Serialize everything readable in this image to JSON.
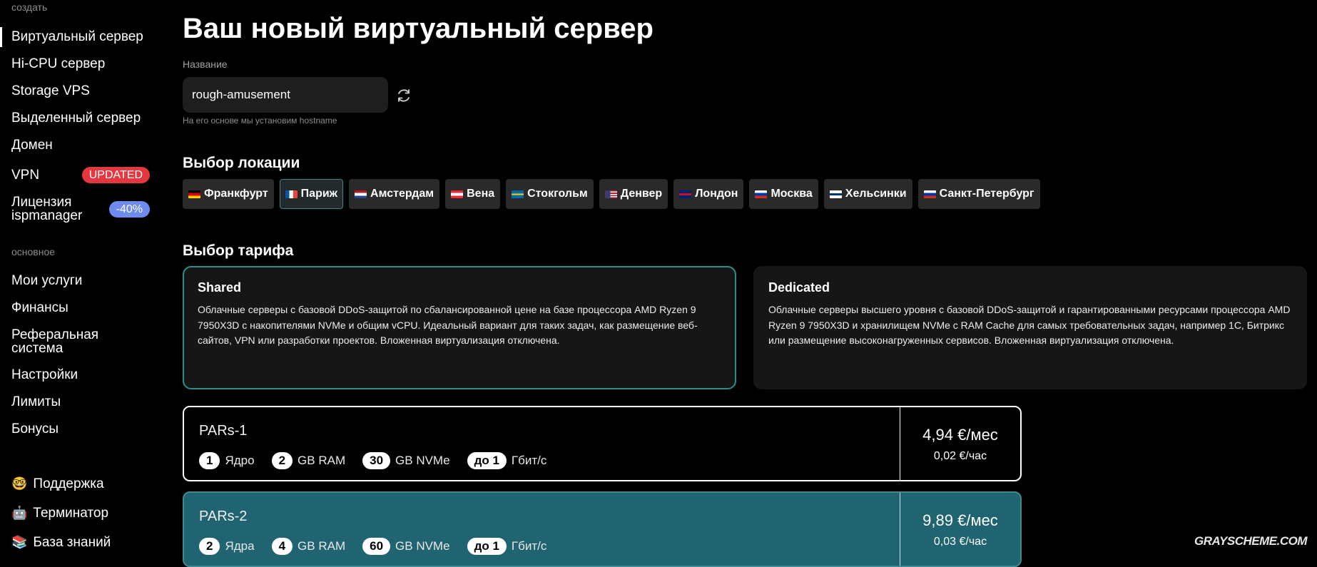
{
  "sidebar": {
    "section_create": "создать",
    "section_main": "основное",
    "create_items": [
      {
        "label": "Виртуальный сервер"
      },
      {
        "label": "Hi-CPU сервер"
      },
      {
        "label": "Storage VPS"
      },
      {
        "label": "Выделенный сервер"
      },
      {
        "label": "Домен"
      },
      {
        "label": "VPN",
        "badge": "UPDATED"
      },
      {
        "label": "Лицензия ispmanager",
        "badge": "-40%"
      }
    ],
    "main_items": [
      {
        "label": "Мои услуги"
      },
      {
        "label": "Финансы"
      },
      {
        "label": "Реферальная система"
      },
      {
        "label": "Настройки"
      },
      {
        "label": "Лимиты"
      },
      {
        "label": "Бонусы"
      }
    ],
    "support_items": [
      {
        "emoji": "🤓",
        "label": "Поддержка"
      },
      {
        "emoji": "🤖",
        "label": "Терминатор"
      },
      {
        "emoji": "📚",
        "label": "База знаний"
      }
    ]
  },
  "page": {
    "title": "Ваш новый виртуальный сервер",
    "name_label": "Название",
    "name_value": "rough-amusement",
    "name_hint": "На его основе мы установим hostname",
    "location_title": "Выбор локации",
    "tariff_title": "Выбор тарифа"
  },
  "locations": [
    {
      "label": "Франкфурт",
      "flag": "de"
    },
    {
      "label": "Париж",
      "flag": "fr",
      "selected": true
    },
    {
      "label": "Амстердам",
      "flag": "nl"
    },
    {
      "label": "Вена",
      "flag": "at"
    },
    {
      "label": "Стокгольм",
      "flag": "se"
    },
    {
      "label": "Денвер",
      "flag": "us"
    },
    {
      "label": "Лондон",
      "flag": "gb"
    },
    {
      "label": "Москва",
      "flag": "ru"
    },
    {
      "label": "Хельсинки",
      "flag": "fi"
    },
    {
      "label": "Санкт-Петербург",
      "flag": "ru"
    }
  ],
  "tariffs": [
    {
      "title": "Shared",
      "description": "Облачные серверы с базовой DDoS-защитой по сбалансированной цене на базе процессора AMD Ryzen 9 7950X3D с накопителями NVMe и общим vCPU. Идеальный вариант для таких задач, как размещение веб-сайтов, VPN или разработки проектов. Вложенная виртуализация отключена."
    },
    {
      "title": "Dedicated",
      "description": "Облачные серверы высшего уровня с базовой DDoS-защитой и гарантированными ресурсами процессора AMD Ryzen 9 7950X3D и хранилищем NVMe с RAM Cache для самых требовательных задач, например 1С, Битрикс или размещение высоконагруженных сервисов. Вложенная виртуализация отключена."
    }
  ],
  "plans": [
    {
      "name": "PARs-1",
      "cores": "1",
      "cores_unit": "Ядро",
      "ram": "2",
      "ram_unit": "GB RAM",
      "disk": "30",
      "disk_unit": "GB NVMe",
      "net": "до 1",
      "net_unit": "Гбит/с",
      "price_month": "4,94 €/мес",
      "price_hour": "0,02 €/час"
    },
    {
      "name": "PARs-2",
      "cores": "2",
      "cores_unit": "Ядра",
      "ram": "4",
      "ram_unit": "GB RAM",
      "disk": "60",
      "disk_unit": "GB NVMe",
      "net": "до 1",
      "net_unit": "Гбит/с",
      "price_month": "9,89 €/мес",
      "price_hour": "0,03 €/час"
    }
  ],
  "watermark": "GRAYSCHEME.COM",
  "colors": {
    "background": "#000000",
    "accent_teal": "#2e8b8f",
    "selected_plan_bg": "#1f6470",
    "badge_updated": "#e5373f",
    "badge_discount": "#6e8cf0"
  }
}
